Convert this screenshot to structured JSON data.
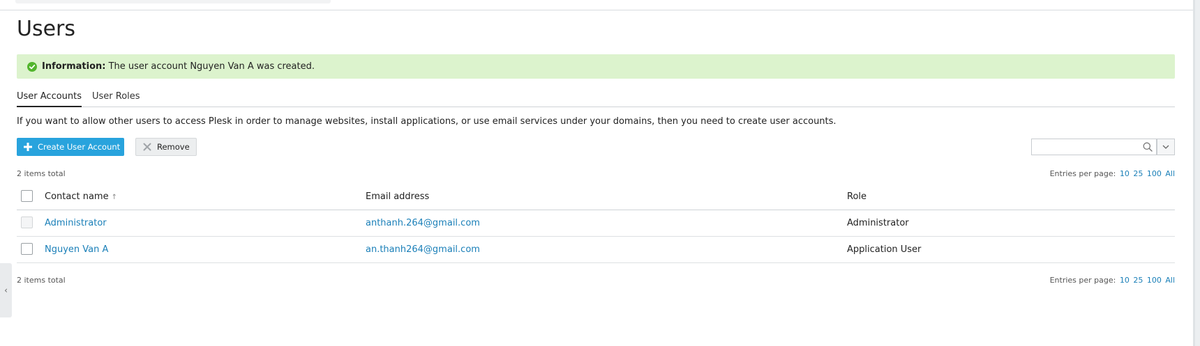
{
  "page": {
    "title": "Users"
  },
  "message": {
    "label": "Information:",
    "text": " The user account Nguyen Van A was created."
  },
  "tabs": [
    {
      "label": "User Accounts",
      "active": true
    },
    {
      "label": "User Roles",
      "active": false
    }
  ],
  "intro": "If you want to allow other users to access Plesk in order to manage websites, install applications, or use email services under your domains, then you need to create user accounts.",
  "toolbar": {
    "create_label": "Create User Account",
    "remove_label": "Remove",
    "search_value": "",
    "search_placeholder": ""
  },
  "pager": {
    "total_text": "2 items total",
    "entries_label": "Entries per page:",
    "options": [
      "10",
      "25",
      "100",
      "All"
    ]
  },
  "table": {
    "headers": {
      "contact": "Contact name",
      "sort_indicator": "↑",
      "email": "Email address",
      "role": "Role"
    },
    "rows": [
      {
        "contact": "Administrator",
        "email": "anthanh.264@gmail.com",
        "role": "Administrator",
        "selectable": false
      },
      {
        "contact": "Nguyen Van A",
        "email": "an.thanh264@gmail.com",
        "role": "Application User",
        "selectable": true
      }
    ]
  },
  "icons": {
    "success": "check-circle-icon",
    "create": "plus-icon",
    "remove": "remove-icon",
    "search": "search-icon",
    "dropdown": "chevron-down-icon",
    "collapse": "chevron-left-icon"
  },
  "colors": {
    "primary": "#28a3dd",
    "success_bg": "#dcf3cd",
    "success_icon": "#52b52d",
    "link": "#1a7fb8"
  }
}
